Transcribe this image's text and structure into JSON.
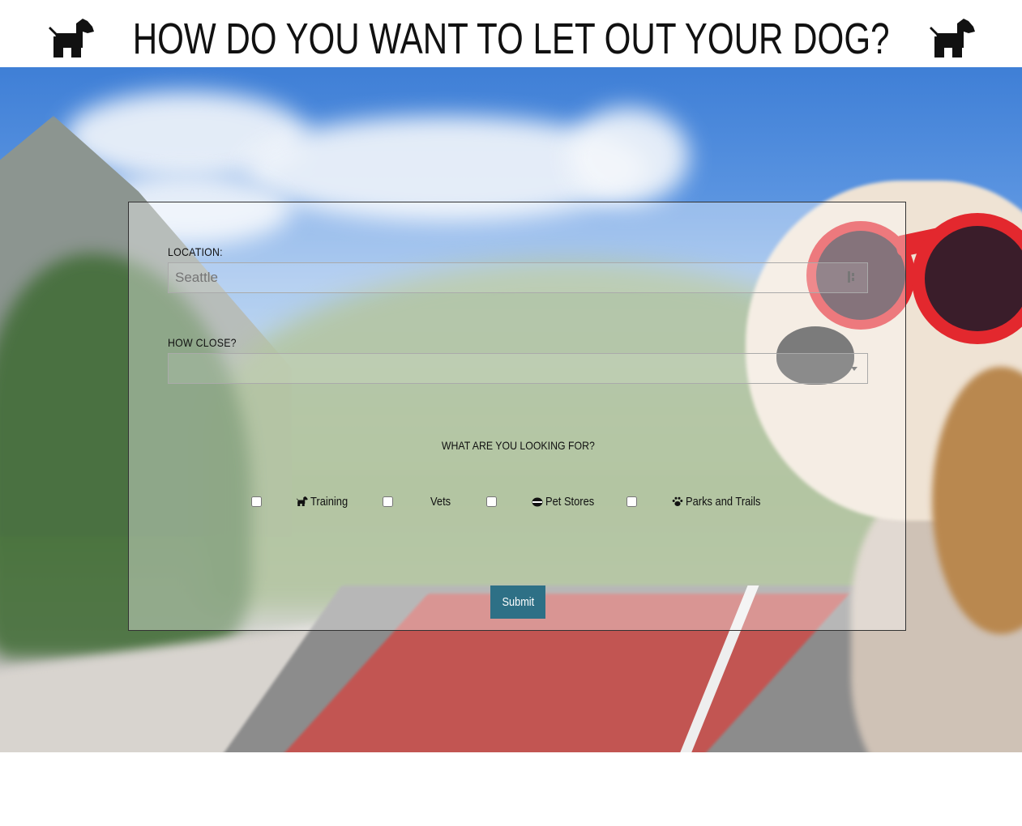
{
  "header": {
    "title": "HOW DO YOU WANT TO LET OUT YOUR DOG?",
    "icon": "dog-icon"
  },
  "form": {
    "location": {
      "label": "LOCATION:",
      "placeholder": "Seattle",
      "value": ""
    },
    "distance": {
      "label": "HOW CLOSE?",
      "selected": ""
    },
    "looking_for": {
      "label": "WHAT ARE YOU LOOKING FOR?",
      "options": [
        {
          "label": "Training",
          "icon": "dog-icon",
          "checked": false
        },
        {
          "label": "Vets",
          "icon": "",
          "checked": false
        },
        {
          "label": "Pet Stores",
          "icon": "bone-icon",
          "checked": false
        },
        {
          "label": "Parks and Trails",
          "icon": "paw-icon",
          "checked": false
        }
      ]
    },
    "submit_label": "Submit"
  },
  "colors": {
    "submit_bg": "#2e7086",
    "panel_border": "#333333"
  }
}
